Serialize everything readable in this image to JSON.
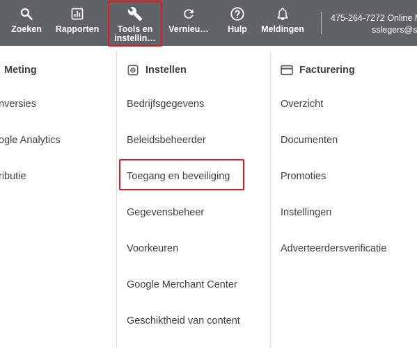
{
  "toolbar": {
    "search_label": "Zoeken",
    "reports_label": "Rapporten",
    "tools_label_line1": "Tools en",
    "tools_label_line2": "instellin…",
    "refresh_label": "Vernieu…",
    "help_label": "Hulp",
    "notifications_label": "Meldingen",
    "account_phone": "475-264-7272 Online M",
    "account_email": "sslegers@st"
  },
  "columns": {
    "measurement": {
      "title": "Meting",
      "items": [
        "nversies",
        "ogle Analytics",
        "ributie"
      ]
    },
    "setup": {
      "title": "Instellen",
      "items": [
        "Bedrijfsgegevens",
        "Beleidsbeheerder",
        "Toegang en beveiliging",
        "Gegevensbeheer",
        "Voorkeuren",
        "Google Merchant Center",
        "Geschiktheid van content"
      ]
    },
    "billing": {
      "title": "Facturering",
      "items": [
        "Overzicht",
        "Documenten",
        "Promoties",
        "Instellingen",
        "Adverteerdersverificatie"
      ]
    }
  },
  "colors": {
    "toolbar_bg": "#5f6368",
    "highlight": "#e3161a",
    "text": "#3c4043"
  }
}
